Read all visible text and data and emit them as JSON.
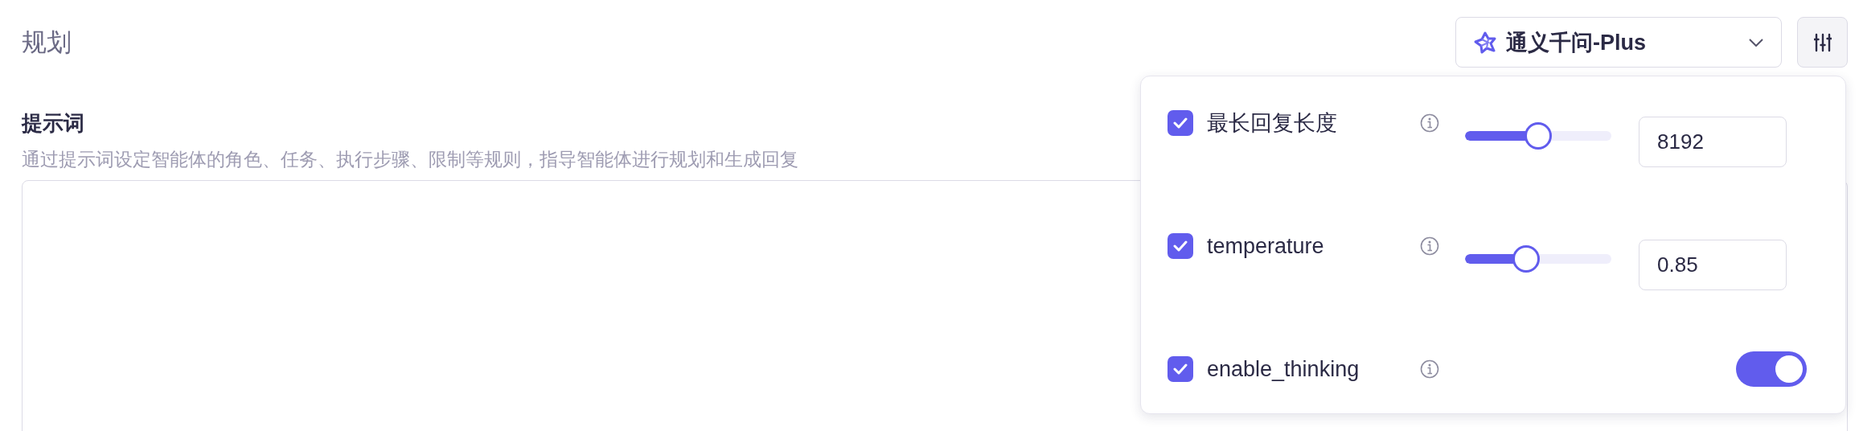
{
  "header": {
    "title": "规划",
    "model_select": {
      "value": "通义千问-Plus"
    }
  },
  "prompt": {
    "label": "提示词",
    "description": "通过提示词设定智能体的角色、任务、执行步骤、限制等规则，指导智能体进行规划和生成回复"
  },
  "settings_popover": {
    "params": [
      {
        "kind": "slider",
        "name": "最长回复长度",
        "enabled": true,
        "level": 0.5,
        "value": "8192"
      },
      {
        "kind": "slider",
        "name": "temperature",
        "enabled": true,
        "level": 0.42,
        "value": "0.85"
      },
      {
        "kind": "switch",
        "name": "enable_thinking",
        "enabled": true,
        "on": true
      }
    ]
  }
}
